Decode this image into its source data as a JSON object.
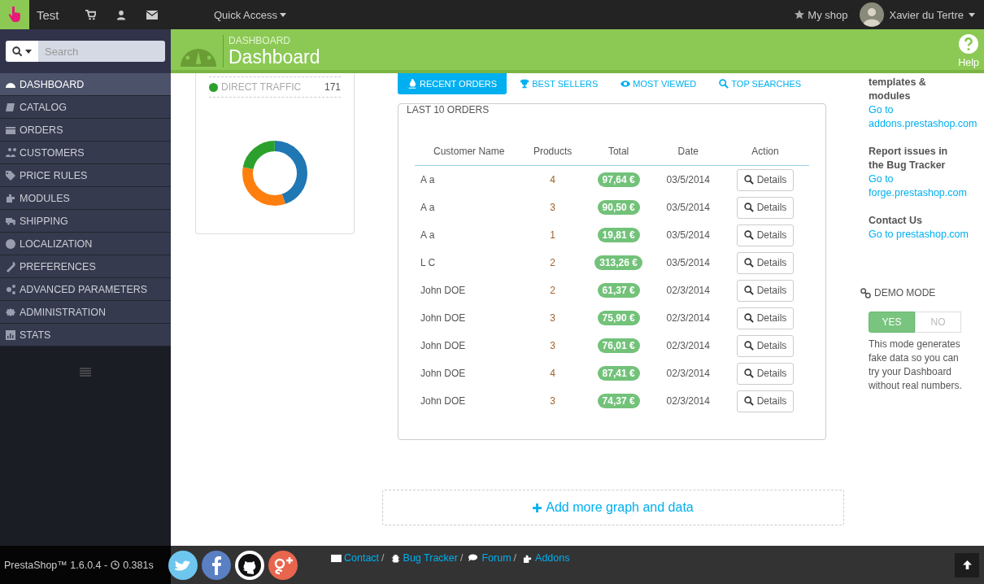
{
  "top_bar": {
    "shop_name": "Test",
    "quick_access": "Quick Access",
    "my_shop": "My shop",
    "user_name": "Xavier du Tertre"
  },
  "sidebar": {
    "search": {
      "placeholder": "Search"
    },
    "items": [
      {
        "label": "DASHBOARD",
        "selected": true
      },
      {
        "label": "CATALOG",
        "selected": false
      },
      {
        "label": "ORDERS",
        "selected": false
      },
      {
        "label": "CUSTOMERS",
        "selected": false
      },
      {
        "label": "PRICE RULES",
        "selected": false
      },
      {
        "label": "MODULES",
        "selected": false
      },
      {
        "label": "SHIPPING",
        "selected": false
      },
      {
        "label": "LOCALIZATION",
        "selected": false
      },
      {
        "label": "PREFERENCES",
        "selected": false
      },
      {
        "label": "ADVANCED PARAMETERS",
        "selected": false
      },
      {
        "label": "ADMINISTRATION",
        "selected": false
      },
      {
        "label": "STATS",
        "selected": false
      }
    ]
  },
  "page_header": {
    "breadcrumb": "DASHBOARD",
    "title": "Dashboard",
    "help": "Help"
  },
  "traffic_widget": {
    "legend": [
      {
        "label": "DIRECT TRAFFIC",
        "value": "171",
        "color": "#2ca02c"
      }
    ]
  },
  "tabs": [
    {
      "label": "RECENT ORDERS",
      "selected": true
    },
    {
      "label": "BEST SELLERS",
      "selected": false
    },
    {
      "label": "MOST VIEWED",
      "selected": false
    },
    {
      "label": "TOP SEARCHES",
      "selected": false
    }
  ],
  "orders_panel": {
    "title": "LAST 10 ORDERS",
    "columns": [
      "Customer Name",
      "Products",
      "Total",
      "Date",
      "Action"
    ],
    "rows": [
      {
        "customer": "A a",
        "products": "4",
        "total": "97,64 €",
        "date": "03/5/2014",
        "action": "Details"
      },
      {
        "customer": "A a",
        "products": "3",
        "total": "90,50 €",
        "date": "03/5/2014",
        "action": "Details"
      },
      {
        "customer": "A a",
        "products": "1",
        "total": "19,81 €",
        "date": "03/5/2014",
        "action": "Details"
      },
      {
        "customer": "L C",
        "products": "2",
        "total": "313,26 €",
        "date": "03/5/2014",
        "action": "Details"
      },
      {
        "customer": "John DOE",
        "products": "2",
        "total": "61,37 €",
        "date": "02/3/2014",
        "action": "Details"
      },
      {
        "customer": "John DOE",
        "products": "3",
        "total": "75,90 €",
        "date": "02/3/2014",
        "action": "Details"
      },
      {
        "customer": "John DOE",
        "products": "3",
        "total": "76,01 €",
        "date": "02/3/2014",
        "action": "Details"
      },
      {
        "customer": "John DOE",
        "products": "4",
        "total": "87,41 €",
        "date": "02/3/2014",
        "action": "Details"
      },
      {
        "customer": "John DOE",
        "products": "3",
        "total": "74,37 €",
        "date": "02/3/2014",
        "action": "Details"
      }
    ]
  },
  "help_links": [
    {
      "title": "templates & modules",
      "link": "Go to addons.prestashop.com"
    },
    {
      "title": "Report issues in the Bug Tracker",
      "link": "Go to forge.prestashop.com"
    },
    {
      "title": "Contact Us",
      "link": "Go to prestashop.com"
    }
  ],
  "demo_mode": {
    "title": "DEMO MODE",
    "options": [
      {
        "label": "YES",
        "selected": true
      },
      {
        "label": "NO",
        "selected": false
      }
    ],
    "description": "This mode generates fake data so you can try your Dashboard without real numbers."
  },
  "add_more": "Add more graph and data",
  "footer": {
    "version": "PrestaShop™ 1.6.0.4 -",
    "time": "0.381s",
    "links": [
      {
        "label": "Contact",
        "separator": "/"
      },
      {
        "label": "Bug Tracker",
        "separator": "/"
      },
      {
        "label": "Forum",
        "separator": "/"
      },
      {
        "label": "Addons"
      }
    ]
  }
}
